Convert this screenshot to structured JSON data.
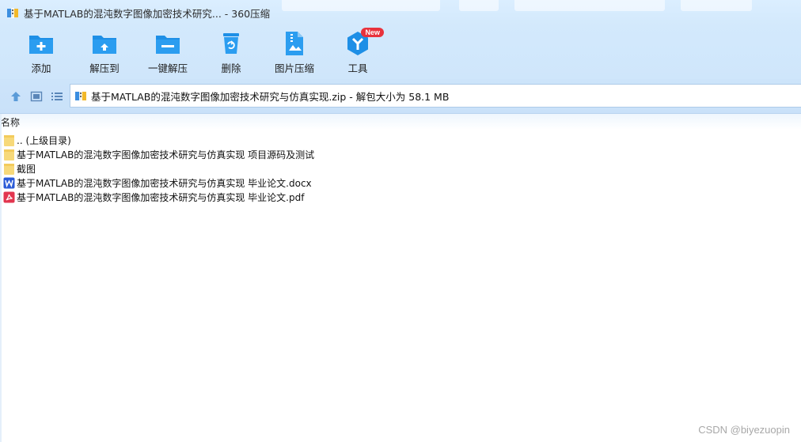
{
  "window": {
    "title": "基于MATLAB的混沌数字图像加密技术研究...",
    "separator": " - ",
    "app_name": "360压缩"
  },
  "toolbar": {
    "items": [
      {
        "label": "添加",
        "icon": "add-folder-icon"
      },
      {
        "label": "解压到",
        "icon": "extract-to-icon"
      },
      {
        "label": "一键解压",
        "icon": "one-click-extract-icon"
      },
      {
        "label": "删除",
        "icon": "delete-trash-icon"
      },
      {
        "label": "图片压缩",
        "icon": "image-compress-icon"
      },
      {
        "label": "工具",
        "icon": "tools-icon",
        "badge": "New"
      }
    ]
  },
  "address": {
    "path": "基于MATLAB的混沌数字图像加密技术研究与仿真实现.zip - 解包大小为 58.1 MB"
  },
  "list": {
    "header_name": "名称",
    "items": [
      {
        "name": ".. (上级目录)",
        "type": "folder"
      },
      {
        "name": "基于MATLAB的混沌数字图像加密技术研究与仿真实现 项目源码及测试",
        "type": "folder"
      },
      {
        "name": "截图",
        "type": "folder"
      },
      {
        "name": "基于MATLAB的混沌数字图像加密技术研究与仿真实现 毕业论文.docx",
        "type": "docx"
      },
      {
        "name": "基于MATLAB的混沌数字图像加密技术研究与仿真实现 毕业论文.pdf",
        "type": "pdf"
      }
    ]
  },
  "watermark": "CSDN @biyezuopin",
  "colors": {
    "accent_blue": "#1e8fe6",
    "badge_red": "#e8323c",
    "folder_yellow": "#f7d97a",
    "word_blue": "#2b5bd7",
    "pdf_red": "#e2364f"
  }
}
